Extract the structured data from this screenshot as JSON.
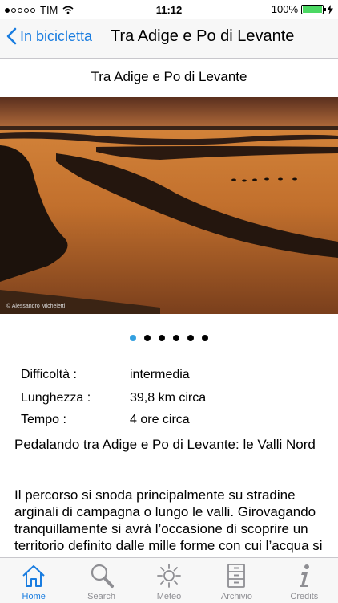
{
  "status": {
    "carrier": "TIM",
    "time": "11:12",
    "battery": "100%",
    "battery_level": 1.0
  },
  "nav": {
    "back_label": "In bicicletta",
    "title": "Tra Adige e Po di Levante"
  },
  "page": {
    "title": "Tra Adige e Po di Levante"
  },
  "photo": {
    "credit": "© Alessandro Micheletti"
  },
  "pager": {
    "count": 6,
    "active": 0
  },
  "details": [
    {
      "label": "Difficoltà :",
      "value": "intermedia"
    },
    {
      "label": "Lunghezza :",
      "value": "39,8 km circa"
    },
    {
      "label": "Tempo :",
      "value": "4 ore circa"
    }
  ],
  "body": {
    "heading": "Pedalando tra Adige e Po di Levante: le Valli Nord",
    "paragraph": "Il percorso si snoda principalmente su stradine arginali di campagna o lungo le valli. Girovagando tranquillamente si avrà l’occasione di scoprire un territorio definito dalle mille forme con cui l’acqua si manifesta. Canali artificiali"
  },
  "tabs": [
    {
      "label": "Home",
      "icon": "home-icon",
      "active": true
    },
    {
      "label": "Search",
      "icon": "search-icon"
    },
    {
      "label": "Meteo",
      "icon": "sun-icon"
    },
    {
      "label": "Archivio",
      "icon": "cabinet-icon"
    },
    {
      "label": "Credits",
      "icon": "info-icon"
    }
  ],
  "colors": {
    "accent": "#1a7de0",
    "pager_active": "#33a0e0"
  }
}
